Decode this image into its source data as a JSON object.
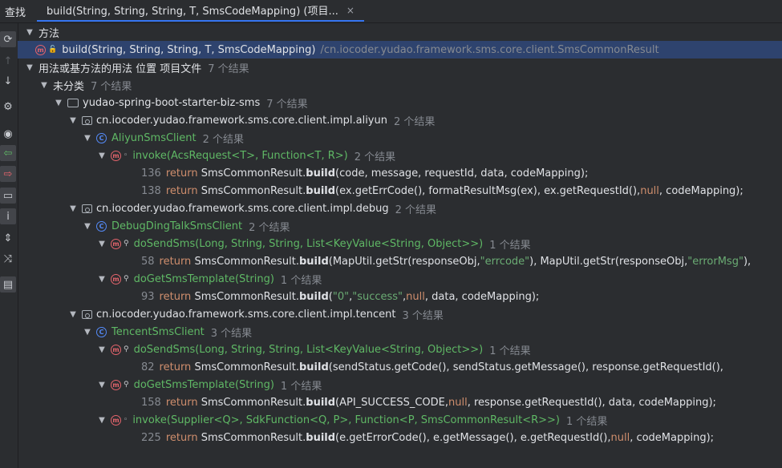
{
  "top": {
    "find_label": "查找",
    "tab_title": "build(String, String, String, T, SmsCodeMapping) (项目...",
    "tab_close": "×"
  },
  "sections": {
    "methods_label": "方法",
    "target_method": "build(String, String, String, T, SmsCodeMapping)",
    "target_path": "/cn.iocoder.yudao.framework.sms.core.client.SmsCommonResult",
    "usages_label": "用法或基方法的用法 位置 项目文件",
    "usages_count": "7 个结果",
    "uncat_label": "未分类",
    "uncat_count": "7 个结果",
    "module": "yudao-spring-boot-starter-biz-sms",
    "module_count": "7 个结果"
  },
  "pkg1": {
    "name": "cn.iocoder.yudao.framework.sms.core.client.impl.aliyun",
    "count": "2 个结果",
    "cls": "AliyunSmsClient",
    "cls_count": "2 个结果",
    "m1": "invoke(AcsRequest<T>, Function<T, R>)",
    "m1_count": "2 个结果",
    "l1_no": "136",
    "l1_a": "SmsCommonResult.",
    "l1_fn": "build",
    "l1_b": "(code, message, requestId, data, codeMapping);",
    "l2_no": "138",
    "l2_a": "SmsCommonResult.",
    "l2_fn": "build",
    "l2_b": "(ex.getErrCode(), formatResultMsg(ex), ex.getRequestId(), ",
    "l2_null": "null",
    "l2_c": ", codeMapping);"
  },
  "pkg2": {
    "name": "cn.iocoder.yudao.framework.sms.core.client.impl.debug",
    "count": "2 个结果",
    "cls": "DebugDingTalkSmsClient",
    "cls_count": "2 个结果",
    "m1": "doSendSms(Long, String, String, List<KeyValue<String, Object>>)",
    "m1_count": "1 个结果",
    "l1_no": "58",
    "l1_a": "SmsCommonResult.",
    "l1_fn": "build",
    "l1_b": "(MapUtil.getStr(responseObj, ",
    "l1_s1": "\"errcode\"",
    "l1_c": "), MapUtil.getStr(responseObj, ",
    "l1_s2": "\"errorMsg\"",
    "l1_d": "),",
    "m2": "doGetSmsTemplate(String)",
    "m2_count": "1 个结果",
    "l2_no": "93",
    "l2_a": "SmsCommonResult.",
    "l2_fn": "build",
    "l2_b": "(",
    "l2_s1": "\"0\"",
    "l2_c": ", ",
    "l2_s2": "\"success\"",
    "l2_d": ", ",
    "l2_null": "null",
    "l2_e": ", data, codeMapping);"
  },
  "pkg3": {
    "name": "cn.iocoder.yudao.framework.sms.core.client.impl.tencent",
    "count": "3 个结果",
    "cls": "TencentSmsClient",
    "cls_count": "3 个结果",
    "m1": "doSendSms(Long, String, String, List<KeyValue<String, Object>>)",
    "m1_count": "1 个结果",
    "l1_no": "82",
    "l1_a": "SmsCommonResult.",
    "l1_fn": "build",
    "l1_b": "(sendStatus.getCode(), sendStatus.getMessage(), response.getRequestId(),",
    "m2": "doGetSmsTemplate(String)",
    "m2_count": "1 个结果",
    "l2_no": "158",
    "l2_a": "SmsCommonResult.",
    "l2_fn": "build",
    "l2_b": "(API_SUCCESS_CODE, ",
    "l2_null": "null",
    "l2_c": ", response.getRequestId(), data, codeMapping);",
    "m3": "invoke(Supplier<Q>, SdkFunction<Q, P>, Function<P, SmsCommonResult<R>>)",
    "m3_count": "1 个结果",
    "l3_no": "225",
    "l3_a": "SmsCommonResult.",
    "l3_fn": "build",
    "l3_b": "(e.getErrorCode(), e.getMessage(), e.getRequestId(), ",
    "l3_null": "null",
    "l3_c": ", codeMapping);"
  },
  "kw_return": "return",
  "icons": {
    "c": "C",
    "m": "m"
  }
}
